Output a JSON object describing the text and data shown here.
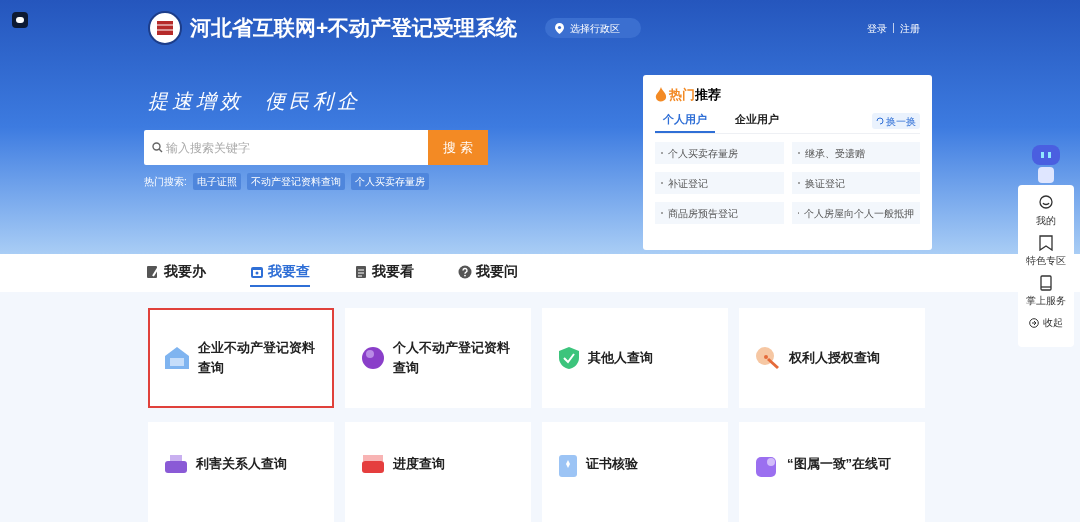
{
  "header": {
    "title": "河北省互联网+不动产登记受理系统",
    "region_selector": "选择行政区",
    "auth_links": [
      "登录",
      "注册"
    ]
  },
  "hero": {
    "slogan": "提速增效  便民利企",
    "search": {
      "placeholder": "输入搜索关键字",
      "button": "搜 索"
    },
    "hot_searches": {
      "label": "热门搜索:",
      "items": [
        "电子证照",
        "不动产登记资料查询",
        "个人买卖存量房"
      ]
    }
  },
  "hot_panel": {
    "title_highlight": "热门",
    "title": "推荐",
    "refresh": "换一换",
    "tabs": [
      {
        "label": "个人用户",
        "selected": true
      },
      {
        "label": "企业用户",
        "selected": false
      }
    ],
    "items": [
      "个人买卖存量房",
      "继承、受遗赠",
      "补证登记",
      "换证登记",
      "商品房预告登记",
      "个人房屋向个人一般抵押"
    ]
  },
  "nav_tabs": [
    {
      "label": "我要办",
      "selected": false
    },
    {
      "label": "我要查",
      "selected": true
    },
    {
      "label": "我要看",
      "selected": false
    },
    {
      "label": "我要问",
      "selected": false
    }
  ],
  "cards": [
    {
      "title": "企业不动产登记资料查询",
      "highlighted": true
    },
    {
      "title": "个人不动产登记资料查询",
      "highlighted": false
    },
    {
      "title": "其他人查询",
      "highlighted": false
    },
    {
      "title": "权利人授权查询",
      "highlighted": false
    },
    {
      "title": "利害关系人查询",
      "highlighted": false
    },
    {
      "title": "进度查询",
      "highlighted": false
    },
    {
      "title": "证书核验",
      "highlighted": false
    },
    {
      "title": "“图属一致”在线可",
      "highlighted": false
    }
  ],
  "side_panel": {
    "items": [
      "我的",
      "特色专区",
      "掌上服务"
    ],
    "collapse": "收起"
  }
}
